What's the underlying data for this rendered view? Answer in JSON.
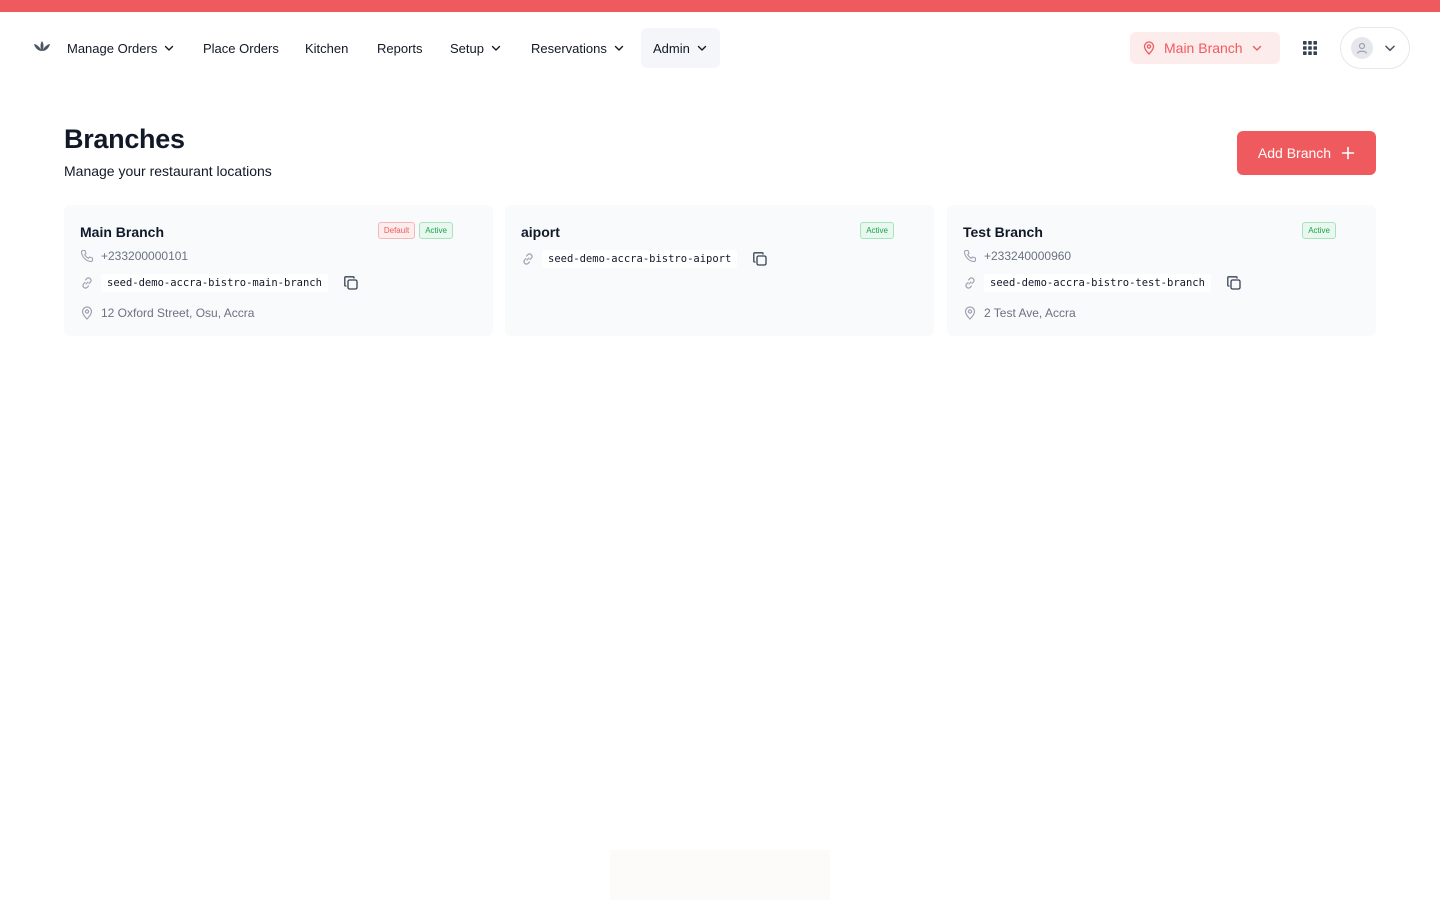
{
  "nav": {
    "items": [
      {
        "label": "Manage Orders",
        "has_dropdown": true
      },
      {
        "label": "Place Orders",
        "has_dropdown": false
      },
      {
        "label": "Kitchen",
        "has_dropdown": false
      },
      {
        "label": "Reports",
        "has_dropdown": false
      },
      {
        "label": "Setup",
        "has_dropdown": true
      },
      {
        "label": "Reservations",
        "has_dropdown": true
      },
      {
        "label": "Admin",
        "has_dropdown": true,
        "active": true
      }
    ],
    "branch_selector": "Main Branch",
    "icons": {
      "logo": "lotus-logo-icon",
      "apps": "grid-icon",
      "user": "user-icon"
    }
  },
  "page": {
    "title": "Branches",
    "subtitle": "Manage your restaurant locations",
    "add_button": "Add Branch"
  },
  "branches": [
    {
      "name": "Main Branch",
      "badges": [
        "Default",
        "Active"
      ],
      "phone": "+233200000101",
      "slug": "seed-demo-accra-bistro-main-branch",
      "address": "12 Oxford Street, Osu, Accra"
    },
    {
      "name": "aiport",
      "badges": [
        "Active"
      ],
      "phone": "",
      "slug": "seed-demo-accra-bistro-aiport",
      "address": ""
    },
    {
      "name": "Test Branch",
      "badges": [
        "Active"
      ],
      "phone": "+233240000960",
      "slug": "seed-demo-accra-bistro-test-branch",
      "address": "2 Test Ave, Accra"
    }
  ],
  "colors": {
    "accent": "#ef5a5f",
    "active_green": "#16a34a",
    "card_bg": "#f8fafc"
  }
}
